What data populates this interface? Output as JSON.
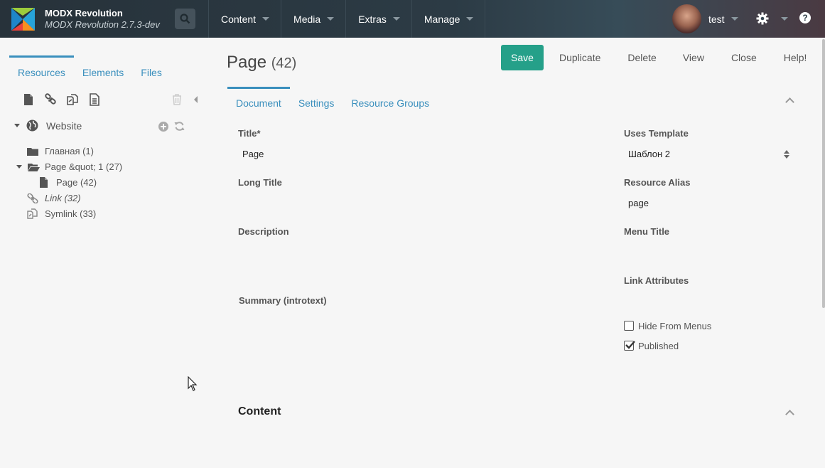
{
  "header": {
    "brand_title": "MODX Revolution",
    "brand_subtitle": "MODX Revolution 2.7.3-dev",
    "nav": [
      {
        "label": "Content"
      },
      {
        "label": "Media"
      },
      {
        "label": "Extras"
      },
      {
        "label": "Manage"
      }
    ],
    "username": "test",
    "help_glyph": "?",
    "colors": {
      "bar": "#2c3b45",
      "accent": "#3a8fbd",
      "save": "#25a089"
    }
  },
  "left": {
    "tabs": [
      {
        "label": "Resources",
        "active": true
      },
      {
        "label": "Elements"
      },
      {
        "label": "Files"
      }
    ],
    "toolbar_icons": [
      "new-document-icon",
      "new-weblink-icon",
      "new-symlink-icon",
      "new-static-resource-icon"
    ],
    "tree": {
      "root": "Website",
      "items": [
        {
          "label": "Главная (1)",
          "icon": "folder-icon"
        },
        {
          "label": "Page &quot; 1 (27)",
          "icon": "folder-open-icon"
        },
        {
          "label": "Page (42)",
          "icon": "document-icon"
        },
        {
          "label": "Link (32)",
          "icon": "link-icon"
        },
        {
          "label": "Symlink (33)",
          "icon": "symlink-icon"
        }
      ]
    }
  },
  "main": {
    "title": "Page",
    "title_id": "(42)",
    "actions": {
      "save": "Save",
      "duplicate": "Duplicate",
      "delete": "Delete",
      "view": "View",
      "close": "Close",
      "help": "Help!"
    },
    "tabs": [
      {
        "label": "Document",
        "active": true
      },
      {
        "label": "Settings"
      },
      {
        "label": "Resource Groups"
      }
    ],
    "fields": {
      "title_label": "Title*",
      "title_value": "Page",
      "long_title_label": "Long Title",
      "description_label": "Description",
      "summary_label": "Summary (introtext)",
      "template_label": "Uses Template",
      "template_value": "Шаблон 2",
      "alias_label": "Resource Alias",
      "alias_value": "page",
      "menu_title_label": "Menu Title",
      "link_attr_label": "Link Attributes",
      "hide_menus_label": "Hide From Menus",
      "hide_menus_checked": false,
      "published_label": "Published",
      "published_checked": true
    },
    "content_heading": "Content"
  }
}
